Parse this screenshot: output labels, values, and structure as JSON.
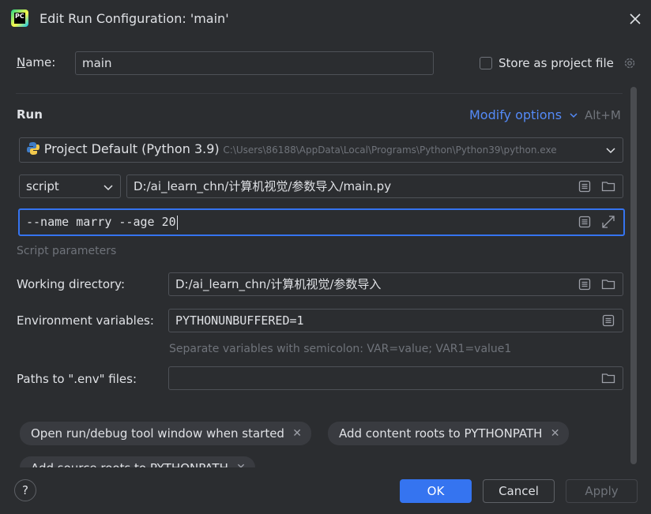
{
  "window": {
    "title": "Edit Run Configuration: 'main'"
  },
  "name_row": {
    "label": "Name:",
    "value": "main",
    "store_label": "Store as project file"
  },
  "run": {
    "section_label": "Run",
    "modify_options": "Modify options",
    "shortcut": "Alt+M"
  },
  "interpreter": {
    "name": "Project Default (Python 3.9)",
    "path": "C:\\Users\\86188\\AppData\\Local\\Programs\\Python\\Python39\\python.exe"
  },
  "script": {
    "type": "script",
    "path": "D:/ai_learn_chn/计算机视觉/参数导入/main.py"
  },
  "parameters": {
    "value": "--name marry --age 20",
    "hint": "Script parameters"
  },
  "working_dir": {
    "label": "Working directory:",
    "value": "D:/ai_learn_chn/计算机视觉/参数导入"
  },
  "env": {
    "label": "Environment variables:",
    "value": "PYTHONUNBUFFERED=1",
    "hint": "Separate variables with semicolon: VAR=value; VAR1=value1"
  },
  "env_files": {
    "label": "Paths to \".env\" files:",
    "value": ""
  },
  "chips": [
    {
      "label": "Open run/debug tool window when started"
    },
    {
      "label": "Add content roots to PYTHONPATH"
    },
    {
      "label": "Add source roots to PYTHONPATH"
    }
  ],
  "buttons": {
    "ok": "OK",
    "cancel": "Cancel",
    "apply": "Apply",
    "help": "?"
  },
  "colors": {
    "background": "#2b2d30",
    "accent": "#3574f0",
    "link": "#548af7"
  }
}
